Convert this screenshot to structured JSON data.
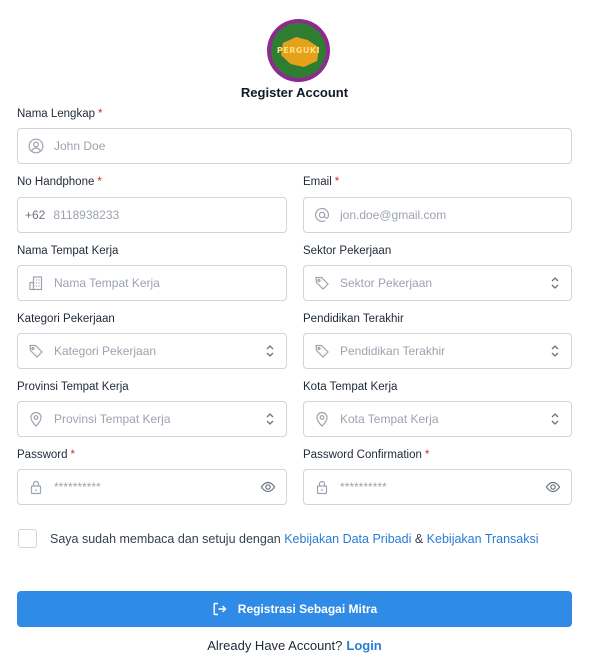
{
  "logo": {
    "text": "PERGUKI"
  },
  "title": "Register Account",
  "required_marker": "*",
  "fields": {
    "full_name": {
      "label": "Nama Lengkap",
      "placeholder": "John Doe"
    },
    "phone": {
      "label": "No Handphone",
      "prefix": "+62",
      "placeholder": "8118938233"
    },
    "email": {
      "label": "Email",
      "placeholder": "jon.doe@gmail.com"
    },
    "workplace": {
      "label": "Nama Tempat Kerja",
      "placeholder": "Nama Tempat Kerja"
    },
    "sector": {
      "label": "Sektor Pekerjaan",
      "placeholder": "Sektor Pekerjaan"
    },
    "category": {
      "label": "Kategori Pekerjaan",
      "placeholder": "Kategori Pekerjaan"
    },
    "education": {
      "label": "Pendidikan Terakhir",
      "placeholder": "Pendidikan Terakhir"
    },
    "province": {
      "label": "Provinsi Tempat Kerja",
      "placeholder": "Provinsi Tempat Kerja"
    },
    "city": {
      "label": "Kota Tempat Kerja",
      "placeholder": "Kota Tempat Kerja"
    },
    "password": {
      "label": "Password",
      "placeholder": "**********"
    },
    "password_confirm": {
      "label": "Password Confirmation",
      "placeholder": "**********"
    }
  },
  "consent": {
    "text_before": "Saya sudah membaca dan setuju dengan ",
    "link1": "Kebijakan Data Pribadi",
    "separator": " & ",
    "link2": "Kebijakan Transaksi"
  },
  "submit_label": "Registrasi Sebagai Mitra",
  "footer": {
    "text": "Already Have Account?",
    "link": "Login"
  },
  "colors": {
    "primary": "#2f8be6",
    "link": "#2b7bd6",
    "required": "#dc2626",
    "border": "#d1d5db"
  }
}
